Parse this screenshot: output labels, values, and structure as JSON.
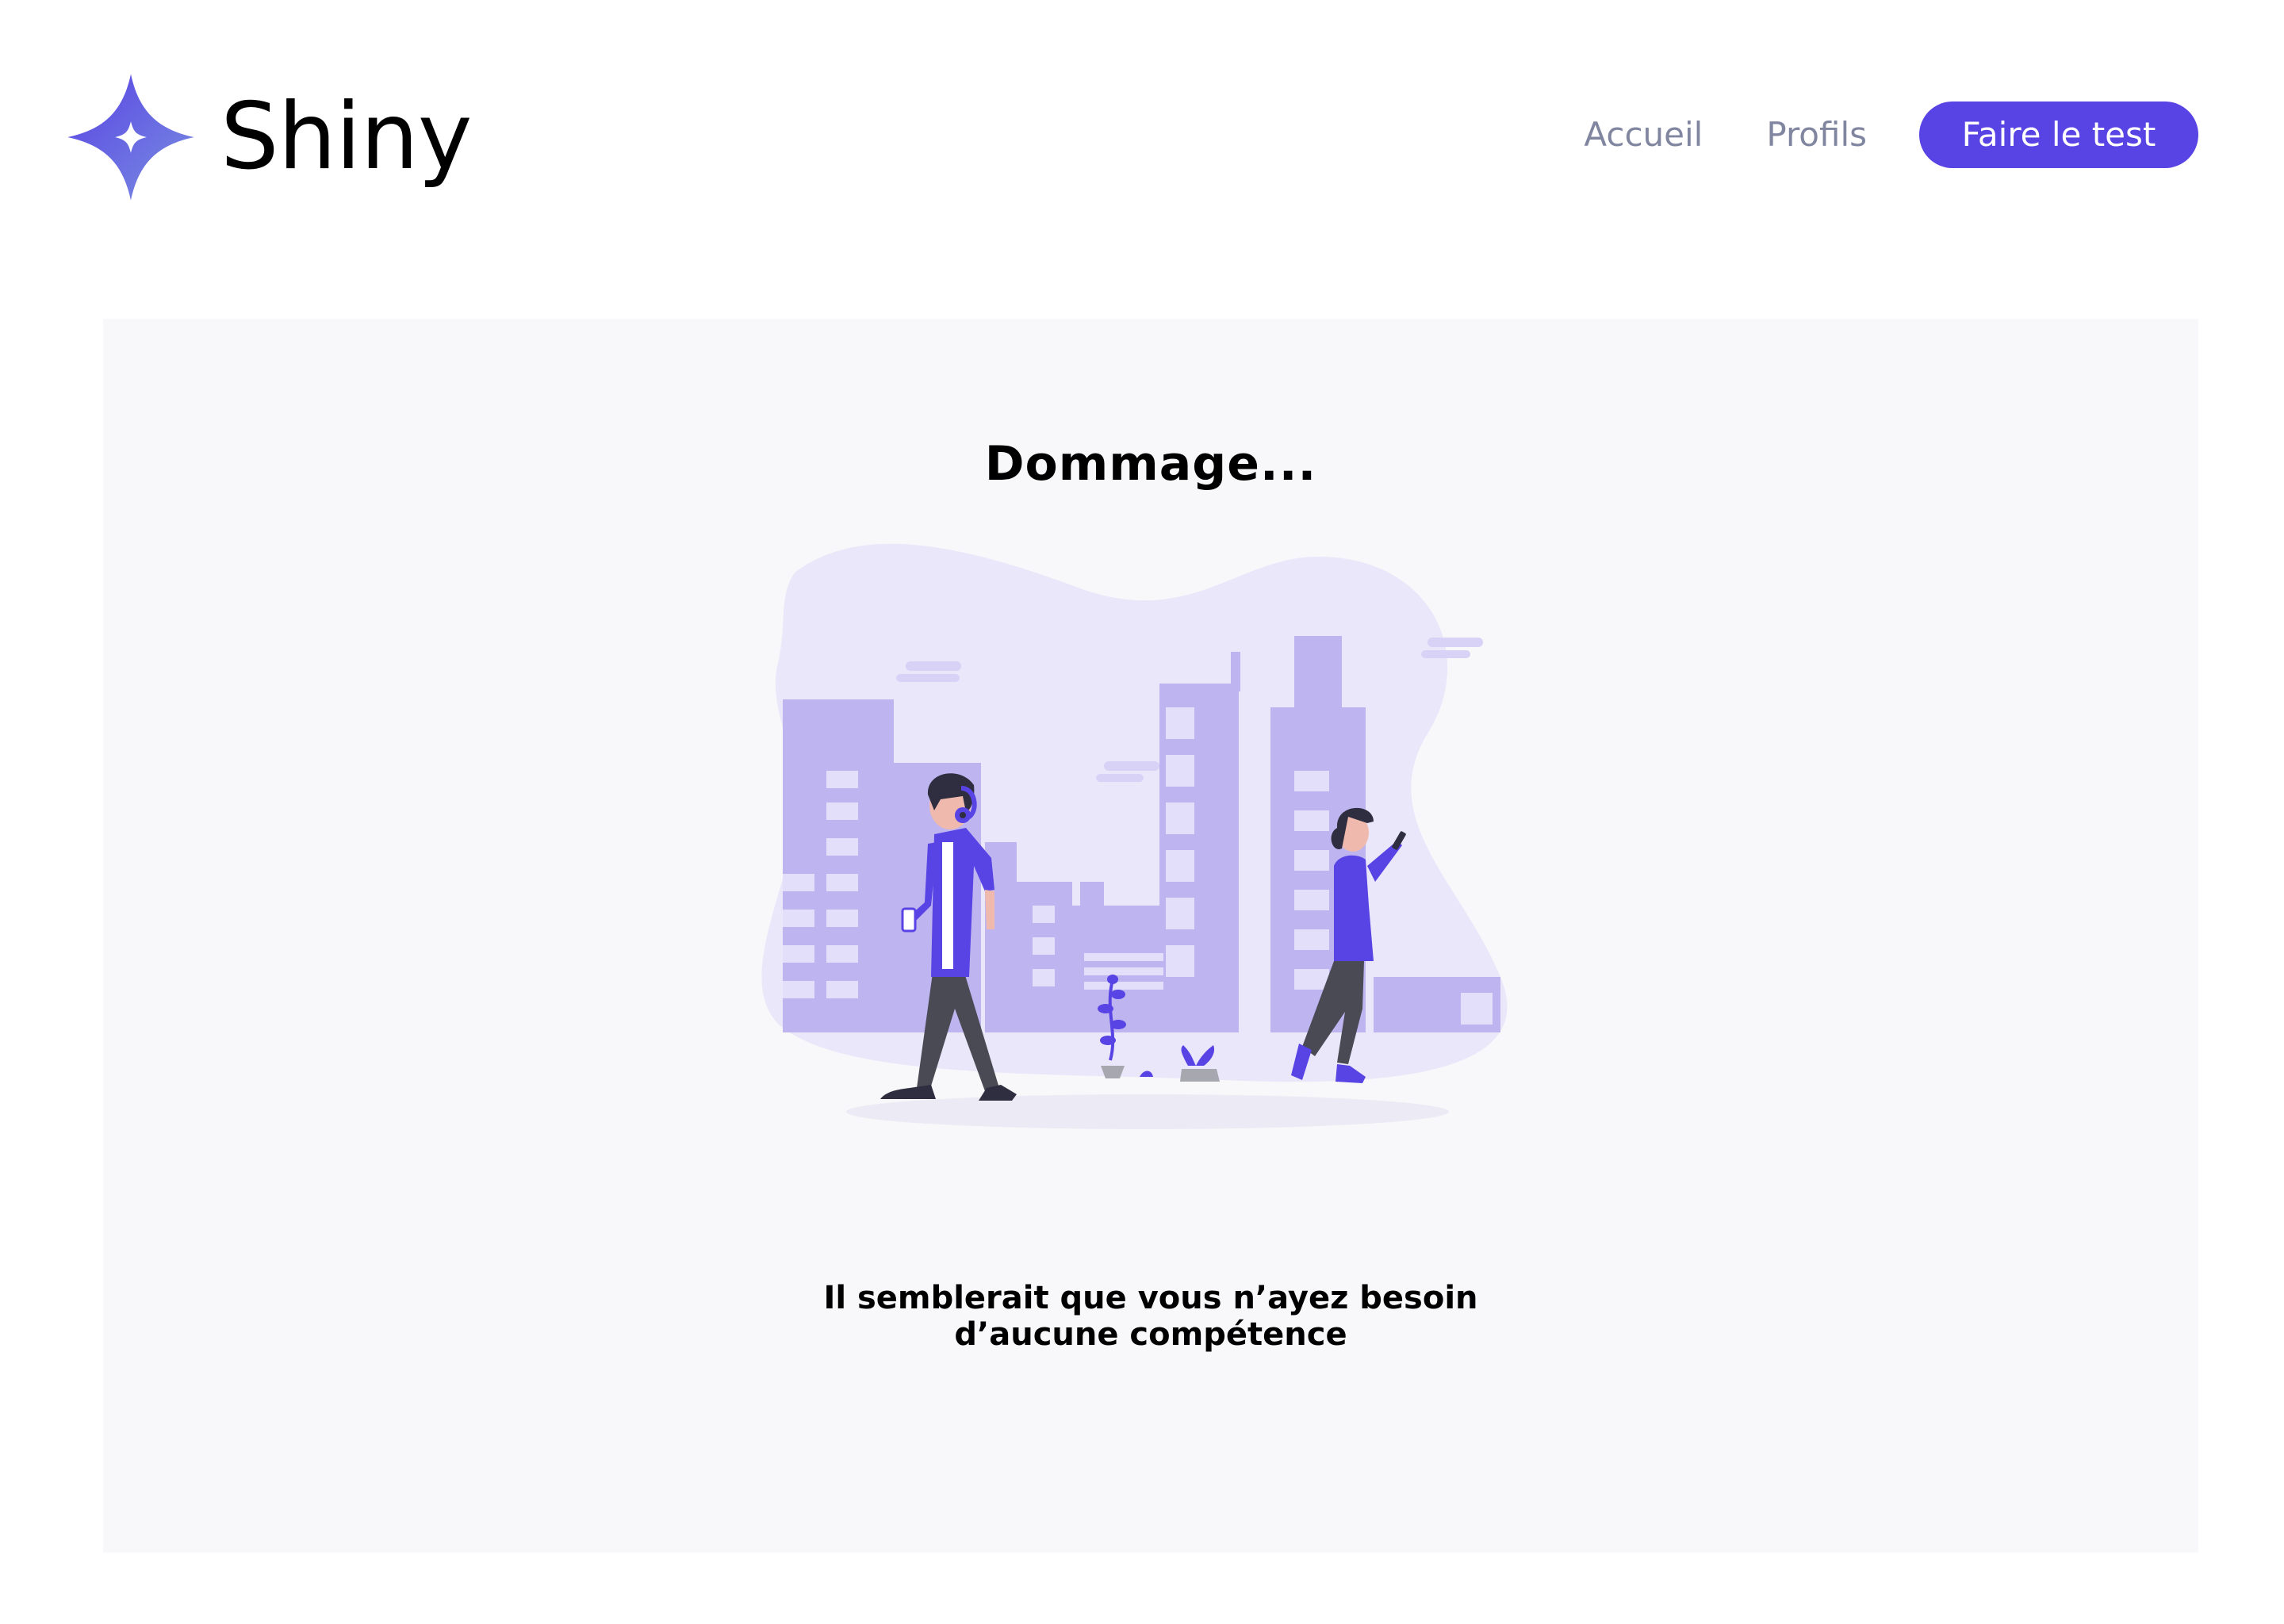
{
  "app": {
    "name": "Shiny",
    "logo_icon": "four-point-star-icon"
  },
  "nav": {
    "items": [
      {
        "label": "Accueil"
      },
      {
        "label": "Profils"
      }
    ],
    "cta_label": "Faire le test"
  },
  "main": {
    "title": "Dommage...",
    "illustration": "people-walking-city-illustration",
    "message_line1": "Il semblerait que vous n’ayez besoin",
    "message_line2": "d’aucune compétence"
  },
  "colors": {
    "accent": "#5843E4",
    "nav_text": "#8186A0",
    "panel_bg": "#F8F8FA",
    "illustration_blob": "#EAE7FA",
    "buildings": "#BEB5F0"
  }
}
